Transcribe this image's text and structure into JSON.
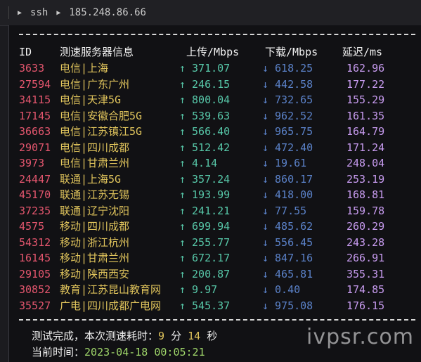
{
  "breadcrumb": {
    "item1": "ssh",
    "item2": "185.248.86.66"
  },
  "table": {
    "headers": {
      "id": "ID",
      "node": "测速服务器信息",
      "up": "上传/Mbps",
      "down": "下载/Mbps",
      "latency": "延迟/ms"
    },
    "up_arrow": "↑",
    "down_arrow": "↓",
    "rows": [
      {
        "id": "3633",
        "node": "电信|上海",
        "up": "371.07",
        "down": "618.25",
        "latency": "162.96"
      },
      {
        "id": "27594",
        "node": "电信|广东广州",
        "up": "246.15",
        "down": "442.58",
        "latency": "177.22"
      },
      {
        "id": "34115",
        "node": "电信|天津5G",
        "up": "800.04",
        "down": "732.65",
        "latency": "155.29"
      },
      {
        "id": "17145",
        "node": "电信|安徽合肥5G",
        "up": "539.63",
        "down": "962.52",
        "latency": "161.35"
      },
      {
        "id": "36663",
        "node": "电信|江苏镇江5G",
        "up": "566.40",
        "down": "965.75",
        "latency": "164.79"
      },
      {
        "id": "29071",
        "node": "电信|四川成都",
        "up": "512.42",
        "down": "472.40",
        "latency": "171.24"
      },
      {
        "id": "3973",
        "node": "电信|甘肃兰州",
        "up": "4.14",
        "down": "19.61",
        "latency": "248.04"
      },
      {
        "id": "24447",
        "node": "联通|上海5G",
        "up": "357.24",
        "down": "860.17",
        "latency": "253.19"
      },
      {
        "id": "45170",
        "node": "联通|江苏无锡",
        "up": "193.99",
        "down": "418.00",
        "latency": "168.81"
      },
      {
        "id": "37235",
        "node": "联通|辽宁沈阳",
        "up": "241.21",
        "down": "77.55",
        "latency": "159.78"
      },
      {
        "id": "4575",
        "node": "移动|四川成都",
        "up": "699.94",
        "down": "485.62",
        "latency": "260.29"
      },
      {
        "id": "54312",
        "node": "移动|浙江杭州",
        "up": "255.77",
        "down": "556.45",
        "latency": "243.28"
      },
      {
        "id": "16145",
        "node": "移动|甘肃兰州",
        "up": "672.17",
        "down": "847.16",
        "latency": "266.91"
      },
      {
        "id": "29105",
        "node": "移动|陕西西安",
        "up": "200.87",
        "down": "465.81",
        "latency": "355.31"
      },
      {
        "id": "30852",
        "node": "教育|江苏昆山教育网",
        "up": "9.97",
        "down": "0.40",
        "latency": "174.85"
      },
      {
        "id": "35527",
        "node": "广电|四川成都广电网",
        "up": "545.37",
        "down": "975.08",
        "latency": "176.15"
      }
    ]
  },
  "footer": {
    "done_label": "测试完成，本次测速耗时：",
    "minutes": "9",
    "min_unit": "分",
    "seconds": "14",
    "sec_unit": "秒",
    "time_label": "当前时间：",
    "time_value": "2023-04-18 00:05:21"
  },
  "watermark": "ivpsr.com"
}
